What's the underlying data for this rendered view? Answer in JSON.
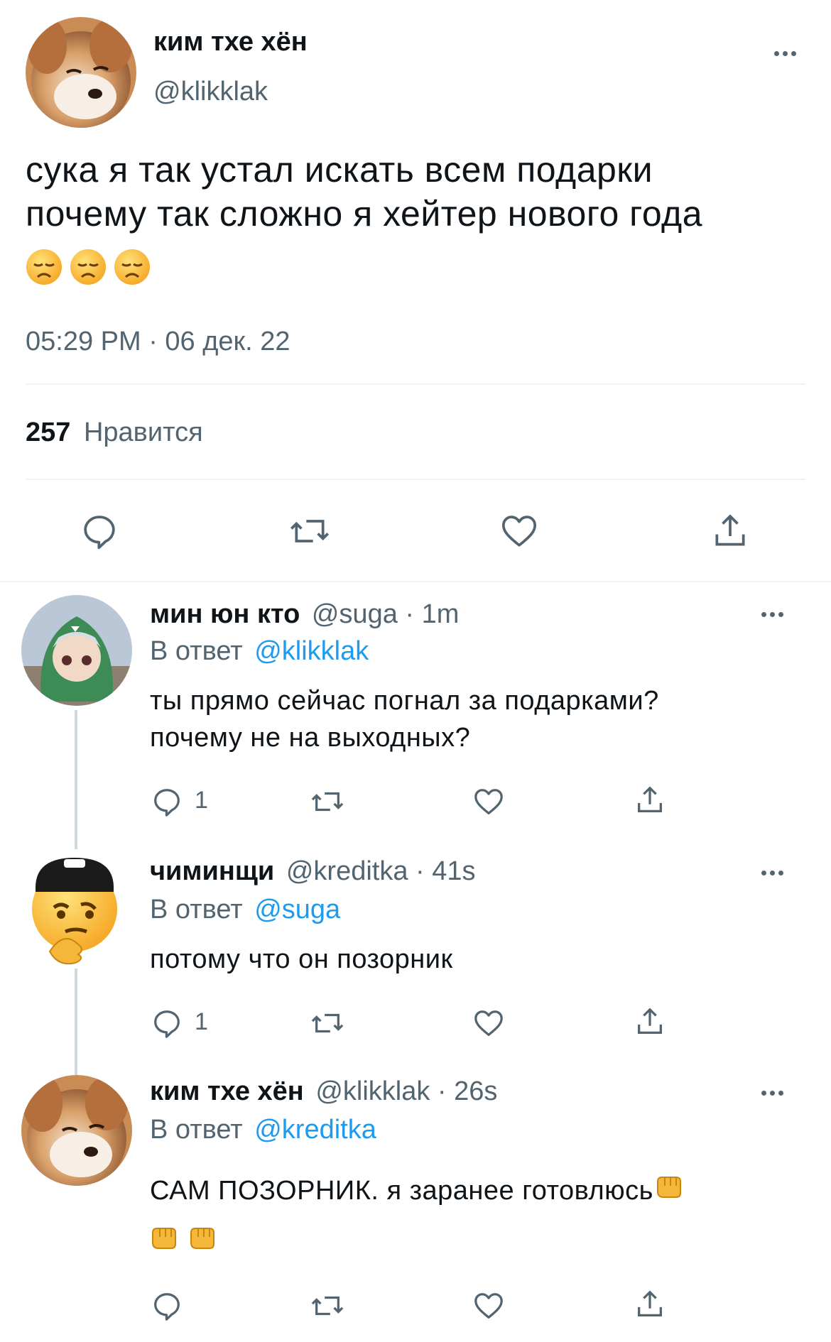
{
  "colors": {
    "accent": "#1d9bf0",
    "muted": "#536471",
    "divider": "#eff3f4"
  },
  "main_tweet": {
    "name": "ким тхе хён",
    "handle": "@klikklak",
    "text_line1": "сука я так устал искать всем подарки",
    "text_line2": "почему так сложно я хейтер нового года",
    "emoji_icons": [
      "disappointed-face-icon",
      "disappointed-face-icon",
      "disappointed-face-icon"
    ],
    "timestamp": "05:29 PM · 06 дек. 22",
    "likes_count": "257",
    "likes_label": "Нравится"
  },
  "replies": [
    {
      "name": "мин юн кто",
      "meta": "@suga · 1m",
      "reply_prefix": "В ответ",
      "reply_to": "@klikklak",
      "text_line1": "ты прямо сейчас погнал за подарками?",
      "text_line2": "почему не на выходных?",
      "reply_count": "1"
    },
    {
      "name": "чиминщи",
      "meta": "@kreditka · 41s",
      "reply_prefix": "В ответ",
      "reply_to": "@suga",
      "text_line1": "потому что он позорник",
      "reply_count": "1"
    },
    {
      "name": "ким тхе хён",
      "meta": "@klikklak · 26s",
      "reply_prefix": "В ответ",
      "reply_to": "@kreditka",
      "text_line1": "САМ ПОЗОРНИК. я заранее готовлюсь",
      "emoji_icons": [
        "oncoming-fist-icon",
        "oncoming-fist-icon",
        "oncoming-fist-icon"
      ]
    }
  ]
}
